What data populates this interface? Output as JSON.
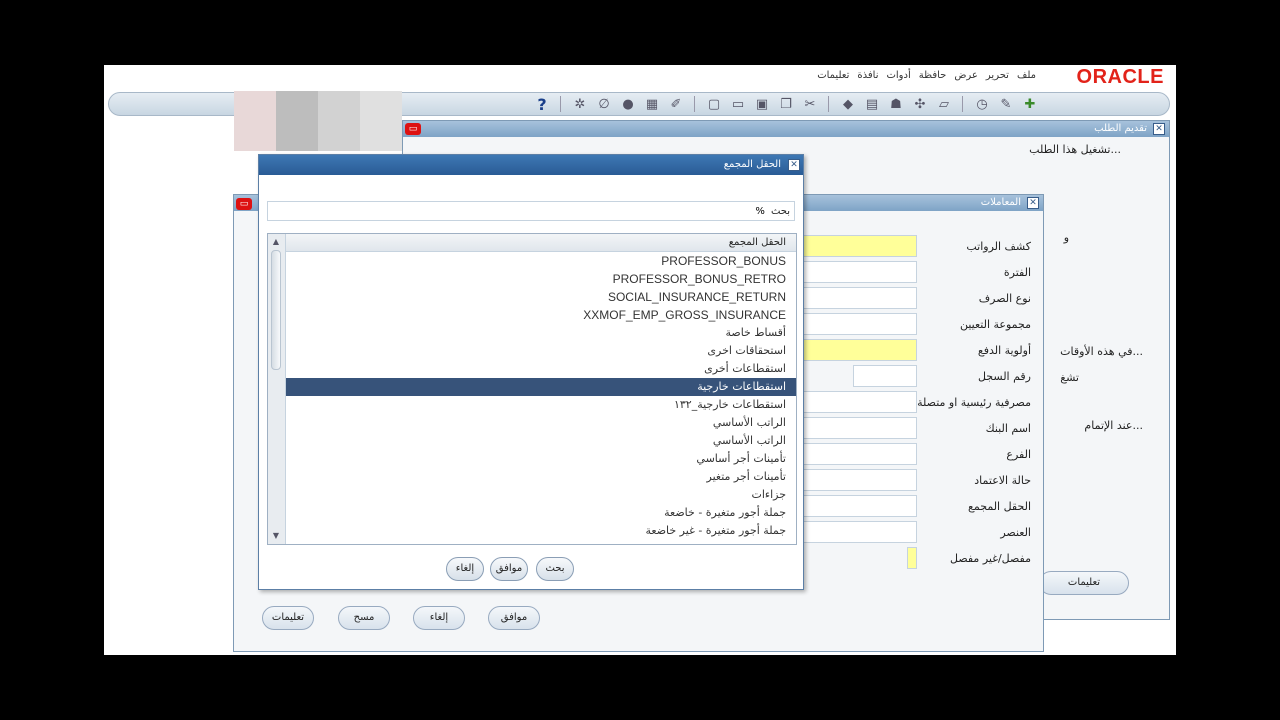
{
  "menubar": {
    "logo": "ORACLE",
    "items": [
      "ملف",
      "تحرير",
      "عرض",
      "حافظة",
      "أدوات",
      "نافذة",
      "تعليمات"
    ]
  },
  "toolbar": {
    "help_glyph": "?"
  },
  "bg_window": {
    "title": "تقديم الطلب",
    "label_run_request": "تشغيل هذا الطلب...",
    "label_at_these_times": "في هذه الأوقات...",
    "label_on_completion": "عند الإتمام...",
    "label_w": "و",
    "label_run": "تشغ",
    "help_button": "تعليمات"
  },
  "params_window": {
    "title": "المعاملات",
    "fields": [
      {
        "label": "كشف الرواتب",
        "required": true
      },
      {
        "label": "الفترة",
        "required": false
      },
      {
        "label": "نوع الصرف",
        "required": false
      },
      {
        "label": "مجموعة التعيين",
        "required": false
      },
      {
        "label": "أولوية الدفع",
        "required": true
      },
      {
        "label": "رقم السجل",
        "required": false
      },
      {
        "label": "مصرفية رئيسية او متصلة",
        "required": false
      },
      {
        "label": "اسم البنك",
        "required": false
      },
      {
        "label": "الفرع",
        "required": false
      },
      {
        "label": "حالة الاعتماد",
        "required": false
      },
      {
        "label": "الحقل المجمع",
        "required": false
      },
      {
        "label": "العنصر",
        "required": false
      },
      {
        "label": "مفصل/غير مفصل",
        "required": false
      }
    ],
    "buttons": {
      "ok": "موافق",
      "cancel": "إلغاء",
      "clear": "مسح",
      "help": "تعليمات"
    }
  },
  "dialog": {
    "title": "الحقل المجمع",
    "search_label": "بحث",
    "search_value": "%",
    "list_header": "الحقل المجمع",
    "rows": [
      {
        "text": "PROFESSOR_BONUS",
        "latin": true
      },
      {
        "text": "PROFESSOR_BONUS_RETRO",
        "latin": true
      },
      {
        "text": "SOCIAL_INSURANCE_RETURN",
        "latin": true
      },
      {
        "text": "XXMOF_EMP_GROSS_INSURANCE",
        "latin": true
      },
      {
        "text": "أقساط خاصة",
        "latin": false
      },
      {
        "text": "استحقاقات اخرى",
        "latin": false
      },
      {
        "text": "استقطاعات أخرى",
        "latin": false
      },
      {
        "text": "استقطاعات خارجية",
        "latin": false,
        "selected": true
      },
      {
        "text": "استقطاعات خارجية_١٣٢",
        "latin": false
      },
      {
        "text": "الراتب الأساسي",
        "latin": false
      },
      {
        "text": "الراتب الأساسي",
        "latin": false
      },
      {
        "text": "تأمينات أجر أساسي",
        "latin": false
      },
      {
        "text": "تأمينات أجر متغير",
        "latin": false
      },
      {
        "text": "جزاءات",
        "latin": false
      },
      {
        "text": "جملة أجور متغيرة - خاضعة",
        "latin": false
      },
      {
        "text": "جملة أجور متغيرة - غير خاضعة",
        "latin": false
      }
    ],
    "buttons": {
      "find": "بحث",
      "ok": "موافق",
      "cancel": "إلغاء"
    }
  },
  "colors": {
    "selected_row": "#37537a",
    "title_bar": "#295b95",
    "required_field": "#ffff99",
    "oracle_red": "#e2231a"
  }
}
